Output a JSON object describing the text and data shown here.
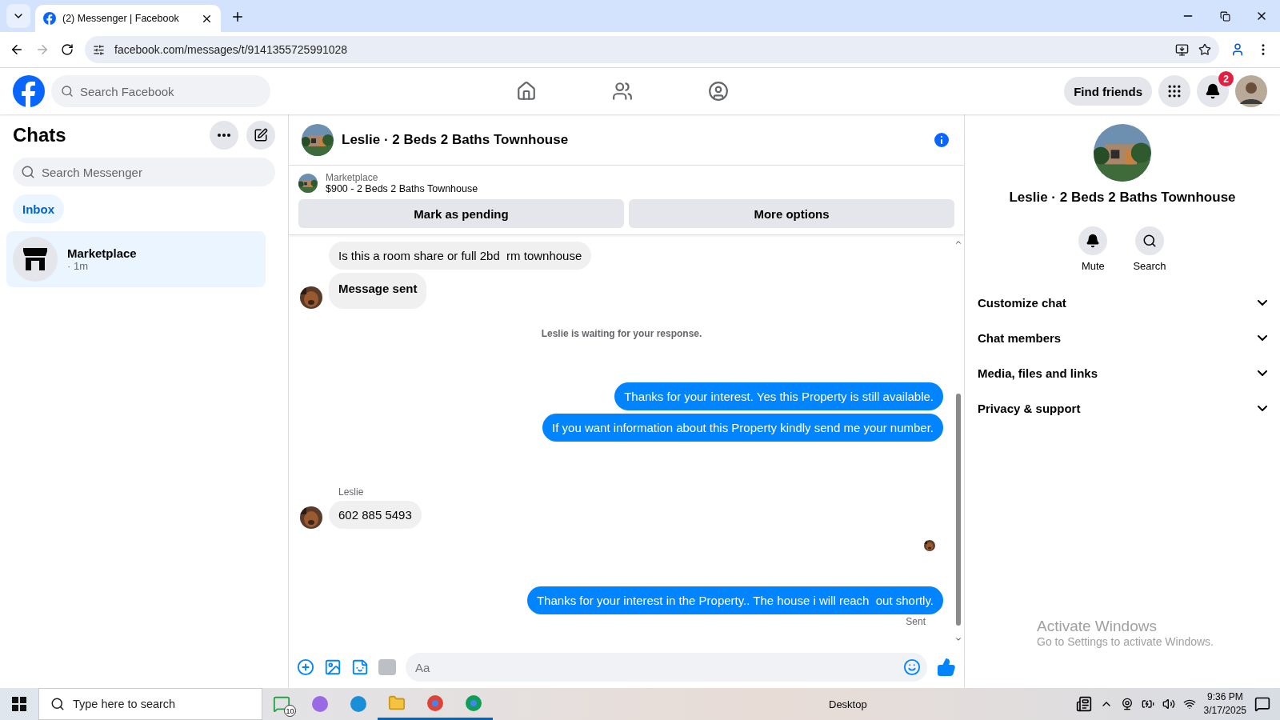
{
  "browser": {
    "tab_title": "(2) Messenger | Facebook",
    "url": "facebook.com/messages/t/9141355725991028"
  },
  "header": {
    "search_placeholder": "Search Facebook",
    "find_friends": "Find friends",
    "notification_count": "2"
  },
  "chats": {
    "title": "Chats",
    "search_placeholder": "Search Messenger",
    "filters": [
      {
        "label": "Inbox",
        "selected": true
      }
    ],
    "conversations": [
      {
        "name": "Marketplace",
        "time": "· 1m",
        "selected": true
      }
    ]
  },
  "conversation": {
    "title": "Leslie · 2 Beds 2 Baths Townhouse",
    "listing": {
      "label": "Marketplace",
      "title": "$900 - 2 Beds 2 Baths Townhouse"
    },
    "buttons": [
      "Mark as pending",
      "More options"
    ],
    "messages": [
      {
        "kind": "incoming",
        "text": "Is this a room share or full 2bd  rm townhouse",
        "avatar": false,
        "emphasis": false
      },
      {
        "kind": "incoming",
        "text": "Message sent",
        "avatar": true,
        "emphasis": true
      },
      {
        "kind": "notice",
        "text": "Leslie is waiting for your response."
      },
      {
        "kind": "outgoing",
        "text": "Thanks for your interest. Yes this Property is still available."
      },
      {
        "kind": "outgoing",
        "text": "If you want information about this Property kindly send me your number."
      },
      {
        "kind": "sender",
        "text": "Leslie"
      },
      {
        "kind": "incoming",
        "text": "602 885 5493",
        "avatar": true,
        "emphasis": false
      },
      {
        "kind": "seen"
      },
      {
        "kind": "outgoing",
        "text": "Thanks for your interest in the Property.. The house i will reach  out shortly."
      },
      {
        "kind": "status",
        "text": "Sent"
      }
    ],
    "composer_placeholder": "Aa"
  },
  "details": {
    "name": "Leslie · 2 Beds 2 Baths Townhouse",
    "actions": [
      {
        "kind": "mute",
        "label": "Mute"
      },
      {
        "kind": "search",
        "label": "Search"
      }
    ],
    "sections": [
      {
        "label": "Customize chat",
        "expanded": false
      },
      {
        "label": "Chat members",
        "expanded": false
      },
      {
        "label": "Media, files and links",
        "expanded": false
      },
      {
        "label": "Privacy & support",
        "expanded": false
      }
    ]
  },
  "activation": {
    "title": "Activate Windows",
    "hint": "Go to Settings to activate Windows."
  },
  "taskbar": {
    "search_placeholder": "Type here to search",
    "whatsapp_badge": "10",
    "desktop_label": "Desktop",
    "time": "9:36 PM",
    "date": "3/17/2025"
  }
}
